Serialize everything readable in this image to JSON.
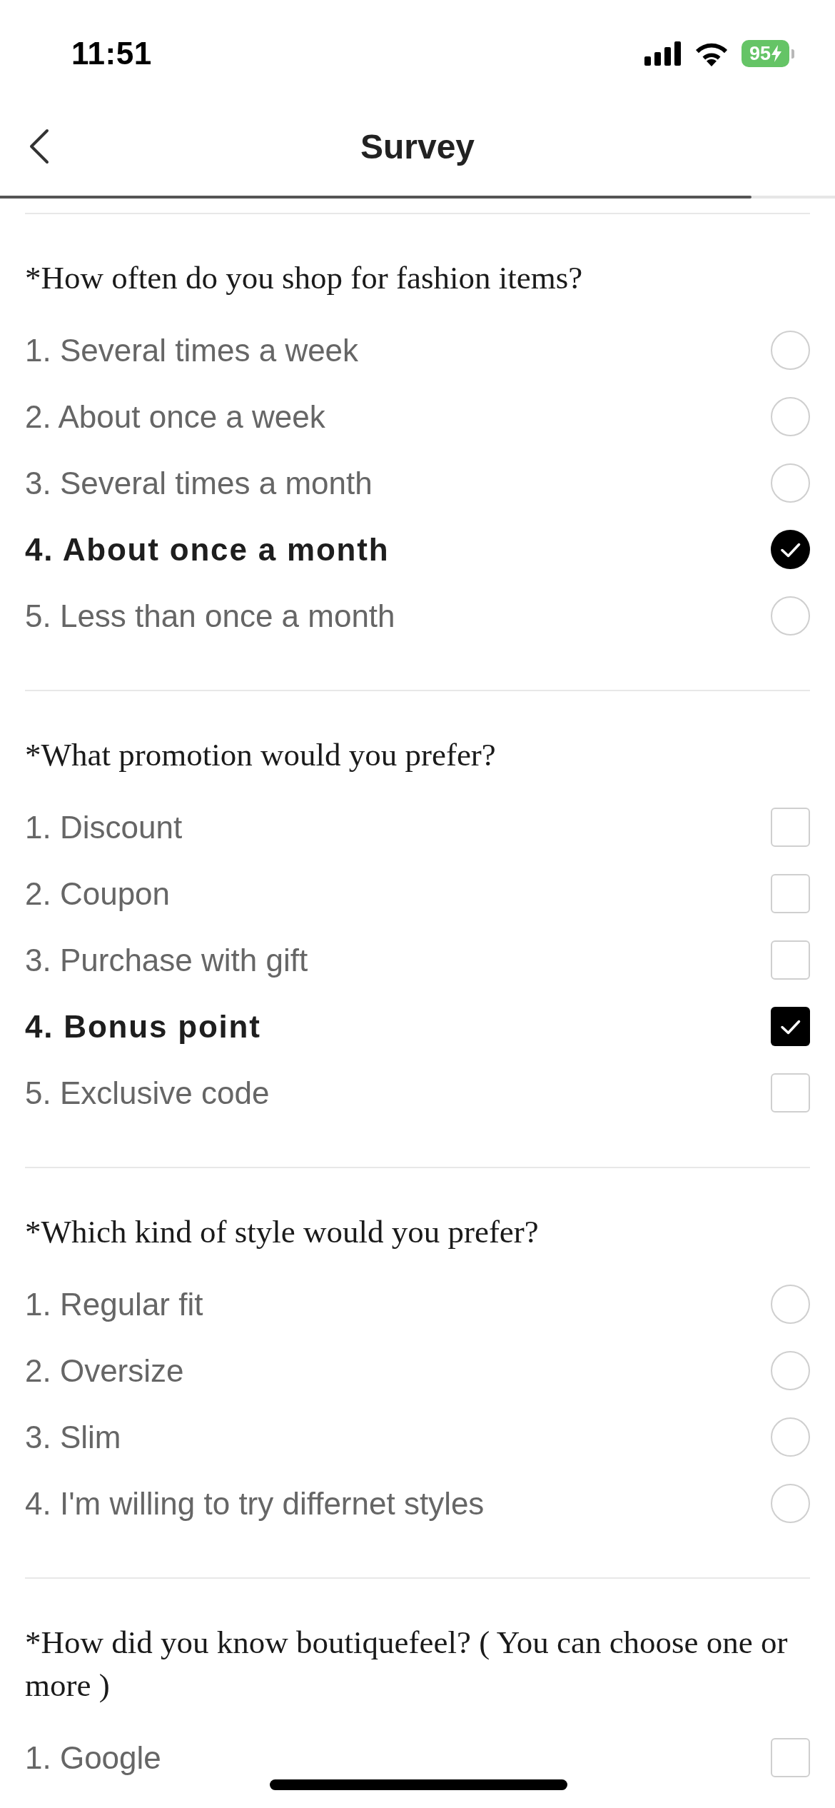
{
  "status_bar": {
    "time": "11:51",
    "battery": "95",
    "charging": true
  },
  "header": {
    "title": "Survey"
  },
  "progress": {
    "level": 0.9
  },
  "questions": [
    {
      "kind": "single",
      "title": "*How often do you shop for fashion items?",
      "options": [
        {
          "label": "1. Several times a week",
          "selected": false
        },
        {
          "label": "2. About once a week",
          "selected": false
        },
        {
          "label": "3. Several times a month",
          "selected": false
        },
        {
          "label": "4. About once a month",
          "selected": true
        },
        {
          "label": "5. Less than once a month",
          "selected": false
        }
      ]
    },
    {
      "kind": "multiple",
      "title": "*What promotion would you prefer?",
      "options": [
        {
          "label": "1. Discount",
          "selected": false
        },
        {
          "label": "2. Coupon",
          "selected": false
        },
        {
          "label": "3. Purchase with gift",
          "selected": false
        },
        {
          "label": "4. Bonus point",
          "selected": true
        },
        {
          "label": "5. Exclusive code",
          "selected": false
        }
      ]
    },
    {
      "kind": "single",
      "title": "*Which kind of style would you prefer?",
      "options": [
        {
          "label": "1. Regular fit",
          "selected": false
        },
        {
          "label": "2. Oversize",
          "selected": false
        },
        {
          "label": "3. Slim",
          "selected": false
        },
        {
          "label": "4. I'm willing to try differnet styles",
          "selected": false
        }
      ]
    },
    {
      "kind": "multiple",
      "title": "*How did you know boutiquefeel? ( You can choose one or more )",
      "options": [
        {
          "label": "1. Google",
          "selected": false
        }
      ]
    }
  ]
}
